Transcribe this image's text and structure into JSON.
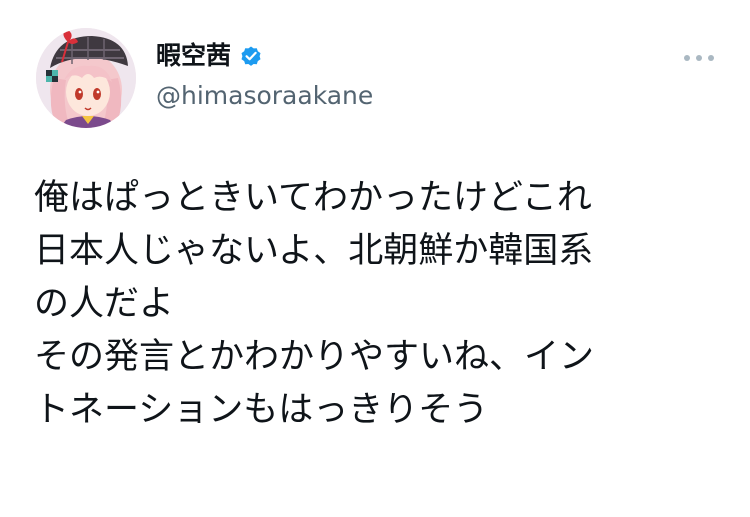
{
  "user": {
    "display_name": "暇空茜",
    "handle": "@himasoraakane",
    "verified": true,
    "avatar": "anime-girl-avatar"
  },
  "tweet": {
    "lines": [
      "俺はぱっときいてわかったけどこれ",
      "日本人じゃないよ、北朝鮮か韓国系",
      "の人だよ",
      "その発言とかわかりやすいね、イン",
      "トネーションもはっきりそう"
    ]
  },
  "icons": {
    "verified": "verified-badge-icon",
    "more": "more-options-icon"
  },
  "colors": {
    "verified_blue": "#1d9bf0",
    "secondary_text": "#536471",
    "primary_text": "#0f1419",
    "more_dots": "#aab8c2"
  }
}
